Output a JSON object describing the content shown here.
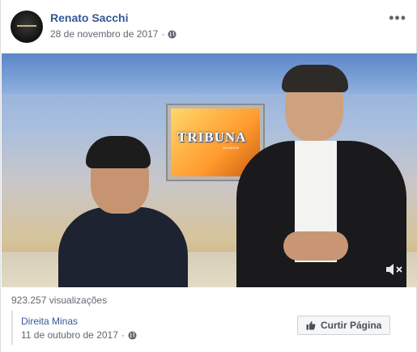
{
  "post": {
    "author": "Renato Sacchi",
    "date": "28 de novembro de 2017",
    "separator": "·",
    "privacy_icon": "globe-icon",
    "more_icon": "more-options-icon",
    "more_label": "•••"
  },
  "video": {
    "monitor_brand": "TRIBUNA",
    "monitor_sub": "DA MASSA",
    "mute_icon": "speaker-muted-icon"
  },
  "stats": {
    "views": "923.257 visualizações"
  },
  "shared": {
    "page_name": "Direita Minas",
    "date": "11 de outubro de 2017",
    "separator": "·",
    "privacy_icon": "globe-icon",
    "like_button": "Curtir Página",
    "like_icon": "thumbs-up-icon"
  },
  "colors": {
    "link": "#365899",
    "meta": "#616770",
    "border": "#dddfe2"
  }
}
